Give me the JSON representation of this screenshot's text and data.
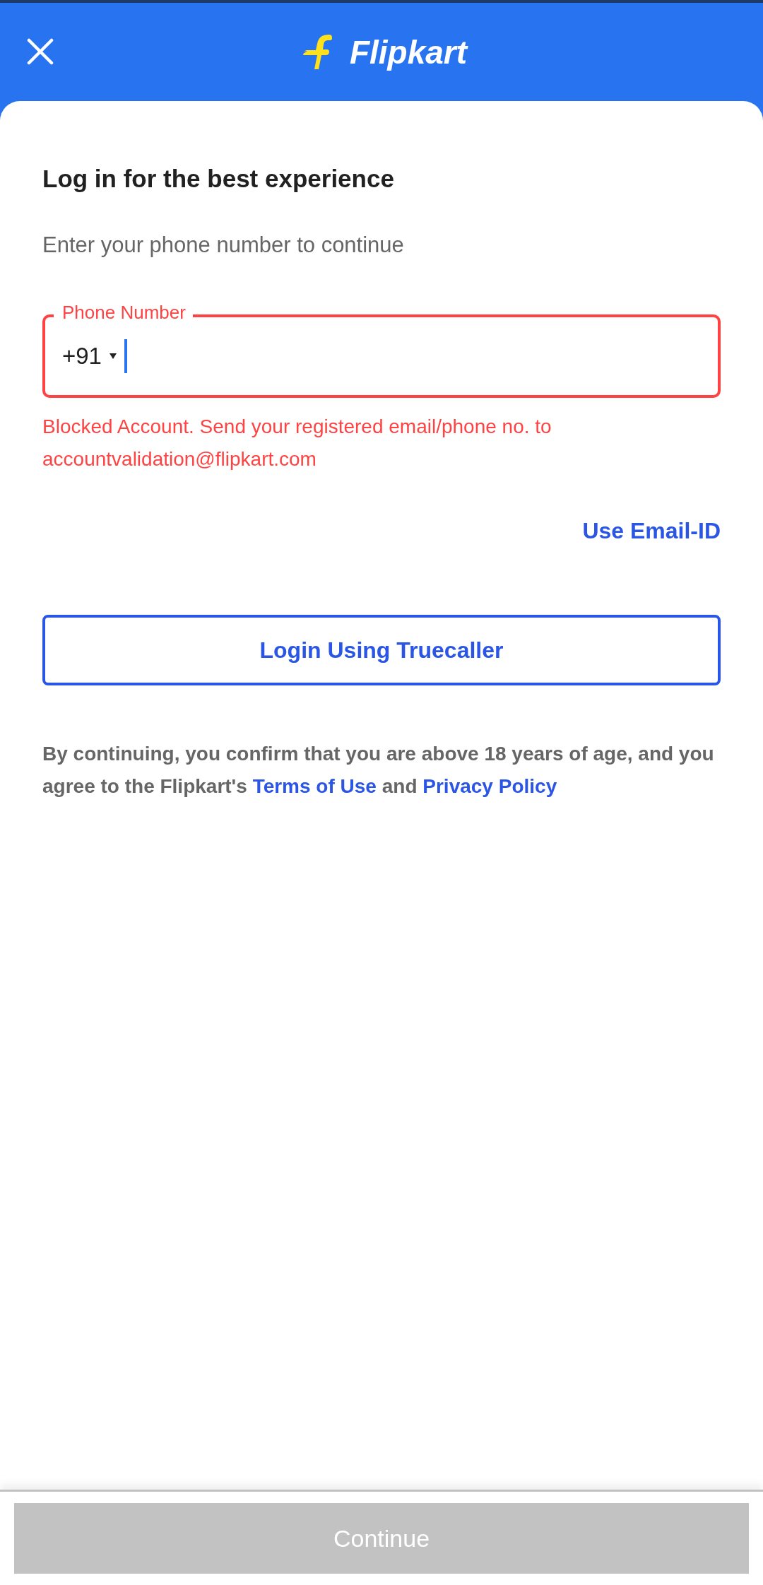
{
  "header": {
    "brand": "Flipkart"
  },
  "title": "Log in for the best experience",
  "subtitle": "Enter your phone number to continue",
  "phone_field": {
    "label": "Phone Number",
    "country_code": "+91",
    "error": true,
    "focused": true
  },
  "error_message": "Blocked Account. Send your registered email/phone no. to accountvalidation@flipkart.com",
  "alt_login_link": "Use Email-ID",
  "truecaller_button": "Login Using Truecaller",
  "consent": {
    "text_before": "By continuing, you confirm that you are above 18 years of age, and you agree to the Flipkart's",
    "link_1": "Terms of Use",
    "text_middle": "and",
    "link_2": "Privacy Policy"
  },
  "continue_button": {
    "label": "Continue",
    "disabled": true
  }
}
